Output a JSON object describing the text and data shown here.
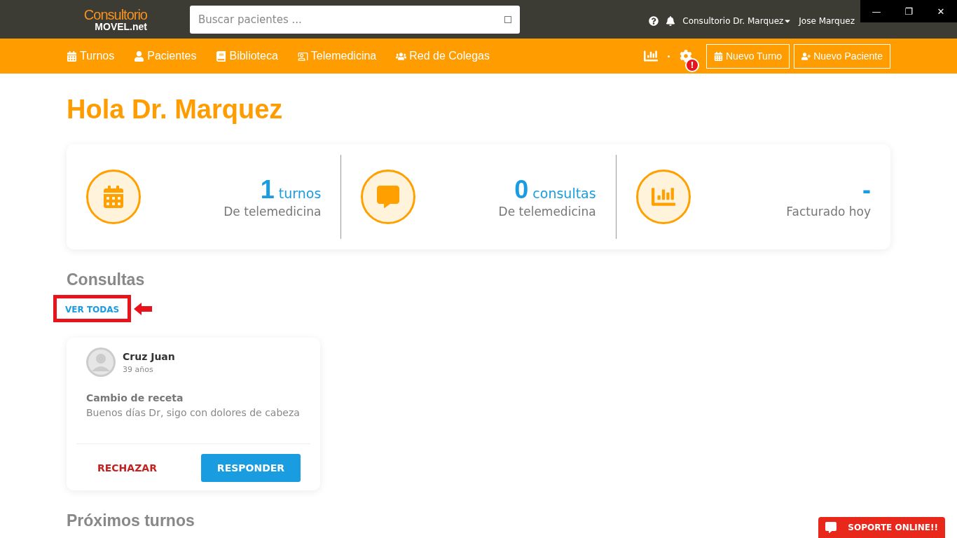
{
  "window_controls": [
    "—",
    "❐",
    "✕"
  ],
  "logo": {
    "line1": "Consultorio",
    "line2": "MOVEL.net"
  },
  "search": {
    "placeholder": "Buscar pacientes ..."
  },
  "top_right": {
    "office": "Consultorio Dr. Marquez",
    "user": "Jose Marquez"
  },
  "nav": [
    {
      "label": "Turnos",
      "kind": "calendar"
    },
    {
      "label": "Pacientes",
      "kind": "user"
    },
    {
      "label": "Biblioteca",
      "kind": "book"
    },
    {
      "label": "Telemedicina",
      "kind": "screen"
    },
    {
      "label": "Red de Colegas",
      "kind": "users"
    }
  ],
  "settings_alert": "!",
  "actions": [
    {
      "label": "Nuevo Turno",
      "kind": "calendar"
    },
    {
      "label": "Nuevo Paciente",
      "kind": "useradd"
    }
  ],
  "greeting": "Hola Dr. Marquez",
  "stats": [
    {
      "kind": "calendar",
      "number": "1",
      "unit": "turnos",
      "caption": "De telemedicina"
    },
    {
      "kind": "chat",
      "number": "0",
      "unit": "consultas",
      "caption": "De telemedicina"
    },
    {
      "kind": "chart",
      "number": "-",
      "caption": "Facturado hoy"
    }
  ],
  "consultas": {
    "title": "Consultas",
    "link": "VER TODAS",
    "items": [
      {
        "name": "Cruz Juan",
        "age": "39 años",
        "subject": "Cambio de receta",
        "message": "Buenos días Dr, sigo con dolores de cabeza",
        "reject": "RECHAZAR",
        "reply": "RESPONDER"
      }
    ]
  },
  "next_title": "Próximos turnos",
  "support": "SOPORTE ONLINE!!"
}
